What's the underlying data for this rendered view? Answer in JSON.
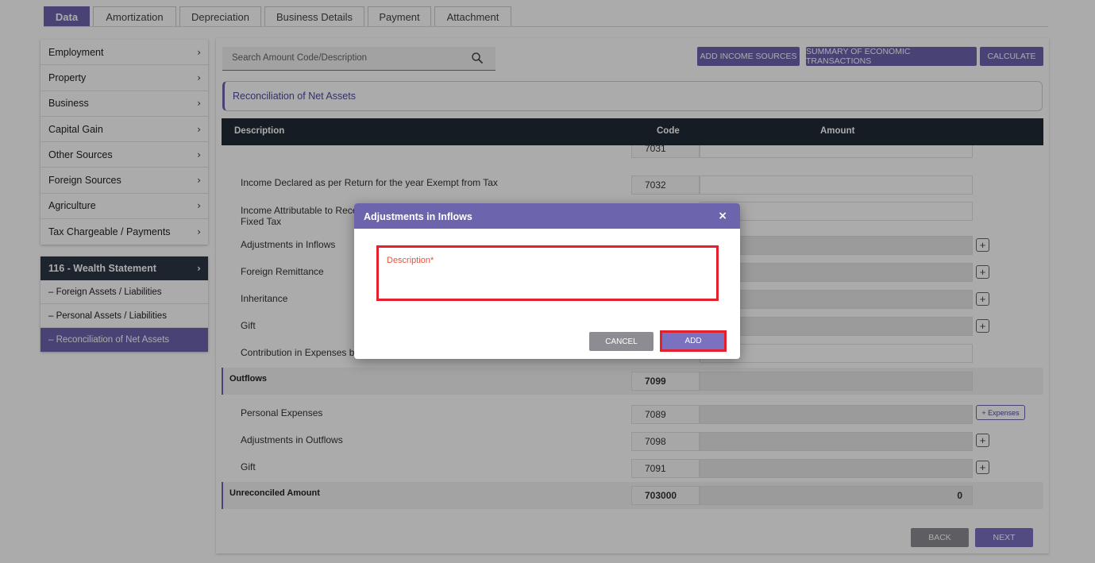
{
  "tabs": [
    "Data",
    "Amortization",
    "Depreciation",
    "Business Details",
    "Payment",
    "Attachment"
  ],
  "sidebar": {
    "items": [
      "Employment",
      "Property",
      "Business",
      "Capital Gain",
      "Other Sources",
      "Foreign Sources",
      "Agriculture",
      "Tax Chargeable / Payments"
    ],
    "section": "116 - Wealth Statement",
    "sub_items": [
      "Foreign Assets / Liabilities",
      "Personal Assets / Liabilities",
      "Reconciliation of Net Assets"
    ]
  },
  "search": {
    "placeholder": "Search Amount Code/Description"
  },
  "toolbar": {
    "add_income": "ADD INCOME SOURCES",
    "summary": "SUMMARY OF ECONOMIC TRANSACTIONS",
    "calculate": "CALCULATE"
  },
  "section_title": "Reconciliation of Net Assets",
  "table": {
    "headers": {
      "description": "Description",
      "code": "Code",
      "amount": "Amount"
    },
    "rows": {
      "r7031": {
        "code": "7031"
      },
      "r7032": {
        "label": "Income Declared as per Return for the year Exempt from Tax",
        "code": "7032"
      },
      "rFixed": {
        "label_line1": "Income Attributable to Receipts",
        "label_line2": "Fixed Tax"
      },
      "rAdjIn": {
        "label": "Adjustments in Inflows"
      },
      "rForeign": {
        "label": "Foreign Remittance"
      },
      "rInherit": {
        "label": "Inheritance"
      },
      "rGift1": {
        "label": "Gift"
      },
      "rContrib": {
        "label": "Contribution in Expenses by"
      },
      "outflows": {
        "label": "Outflows",
        "code": "7099"
      },
      "personal": {
        "label": "Personal Expenses",
        "code": "7089",
        "button": "+ Expenses"
      },
      "adjOut": {
        "label": "Adjustments in Outflows",
        "code": "7098"
      },
      "gift2": {
        "label": "Gift",
        "code": "7091"
      },
      "unrec": {
        "label": "Unreconciled Amount",
        "code": "703000",
        "amount": "0"
      }
    }
  },
  "footer": {
    "back": "BACK",
    "next": "NEXT"
  },
  "modal": {
    "title": "Adjustments in Inflows",
    "close": "×",
    "field_label": "Description*",
    "cancel": "CANCEL",
    "add": "ADD"
  },
  "colors": {
    "accent": "#6c64ad",
    "header_dark": "#212a36",
    "highlight": "#e3202b"
  }
}
